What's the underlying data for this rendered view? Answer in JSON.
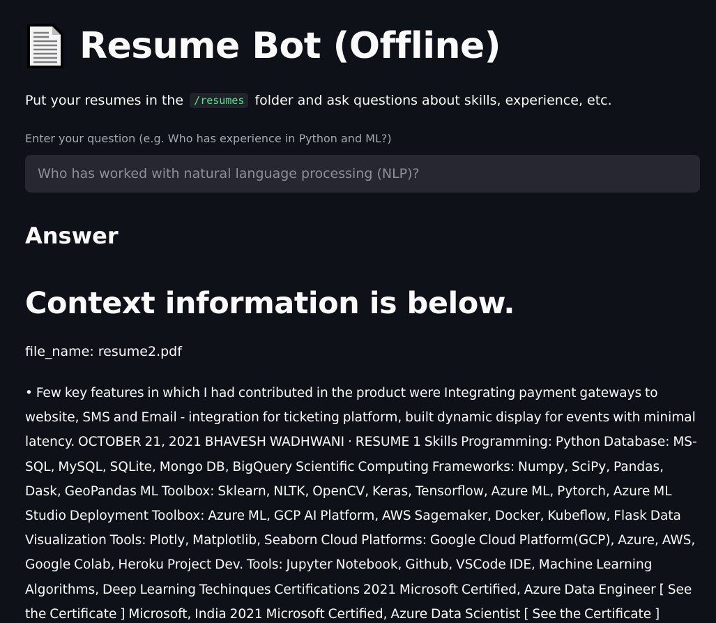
{
  "header": {
    "icon": "document-icon",
    "title": "Resume Bot (Offline)"
  },
  "intro": {
    "before": "Put your resumes in the",
    "code": "/resumes",
    "after": "folder and ask questions about skills, experience, etc."
  },
  "question": {
    "label": "Enter your question (e.g. Who has experience in Python and ML?)",
    "placeholder": "Who has worked with natural language processing (NLP)?"
  },
  "answer": {
    "heading": "Answer",
    "context_heading": "Context information is below.",
    "file_name": "file_name: resume2.pdf",
    "body": "• Few key features in which I had contributed in the product were Integrating payment gateways to website, SMS and Email - integration for ticketing platform, built dynamic display for events with minimal latency. OCTOBER 21, 2021 BHAVESH WADHWANI · RESUME 1 Skills Programming: Python Database: MS-SQL, MySQL, SQLite, Mongo DB, BigQuery Scientific Computing Frameworks: Numpy, SciPy, Pandas, Dask, GeoPandas ML Toolbox: Sklearn, NLTK, OpenCV, Keras, Tensorflow, Azure ML, Pytorch, Azure ML Studio Deployment Toolbox: Azure ML, GCP AI Platform, AWS Sagemaker, Docker, Kubeflow, Flask Data Visualization Tools: Plotly, Matplotlib, Seaborn Cloud Platforms: Google Cloud Platform(GCP), Azure, AWS, Google Colab, Heroku Project Dev. Tools: Jupyter Notebook, Github, VSCode IDE, Machine Learning Algorithms, Deep Learning Techinques Certifications 2021 Microsoft Certified, Azure Data Engineer [ See the Certificate ] Microsoft, India 2021 Microsoft Certified, Azure Data Scientist [ See the Certificate ]"
  },
  "colors": {
    "background": "#0e1117",
    "text": "#fafafa",
    "input_background": "#262730",
    "code_text": "#5ce488",
    "label_text": "#a3a8b4"
  }
}
